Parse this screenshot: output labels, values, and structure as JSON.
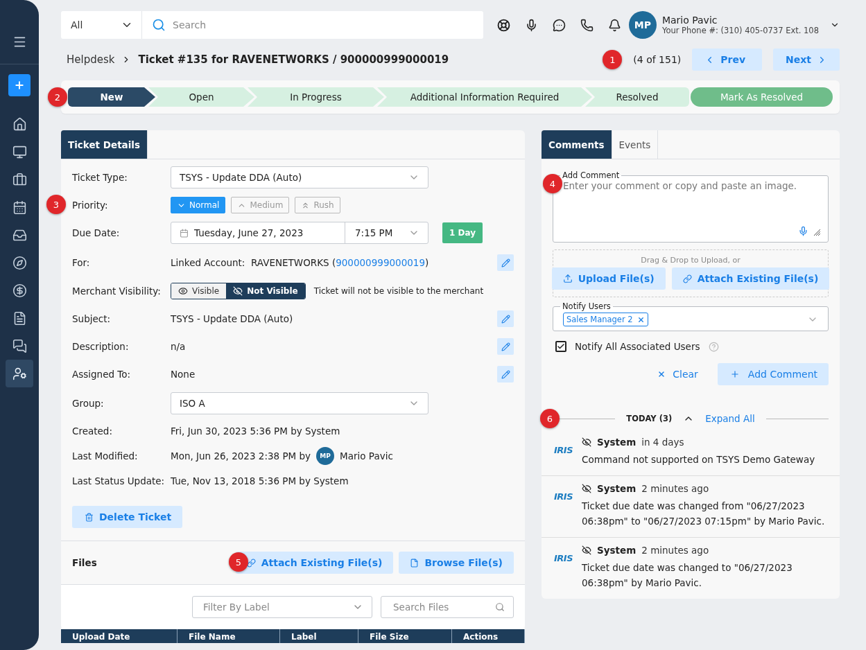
{
  "sidebar": {
    "items": [
      {
        "kind": "menu",
        "selected": false
      },
      {
        "kind": "add",
        "selected": false
      },
      {
        "kind": "home",
        "selected": false
      },
      {
        "kind": "monitor",
        "selected": false
      },
      {
        "kind": "briefcase",
        "selected": false
      },
      {
        "kind": "calendar",
        "selected": false
      },
      {
        "kind": "inbox",
        "selected": false
      },
      {
        "kind": "compass",
        "selected": false
      },
      {
        "kind": "dollar",
        "selected": false
      },
      {
        "kind": "document",
        "selected": false
      },
      {
        "kind": "chat",
        "selected": false
      },
      {
        "kind": "user-settings",
        "selected": true
      }
    ]
  },
  "search": {
    "scope": "All",
    "placeholder": "Search"
  },
  "user": {
    "initials": "MP",
    "name": "Mario Pavic",
    "phone": "Your Phone #: (310) 405-0737 Ext. 108"
  },
  "breadcrumb": {
    "root": "Helpdesk",
    "current": "Ticket #135 for RAVENETWORKS / 900000999000019"
  },
  "pager": {
    "position": "(4 of 151)",
    "prev": "Prev",
    "next": "Next"
  },
  "stages": [
    {
      "label": "New",
      "selected": true
    },
    {
      "label": "Open",
      "selected": false
    },
    {
      "label": "In Progress",
      "selected": false
    },
    {
      "label": "Additional Information Required",
      "selected": false
    },
    {
      "label": "Resolved",
      "selected": false
    }
  ],
  "resolve_button": "Mark As Resolved",
  "markers": [
    "1",
    "2",
    "3",
    "4",
    "5",
    "6"
  ],
  "ticket_details": {
    "tab": "Ticket Details",
    "fields": [
      {
        "kind": "select",
        "label": "Ticket Type:",
        "value": "TSYS - Update DDA (Auto)"
      },
      {
        "kind": "priority",
        "label": "Priority:",
        "options": [
          {
            "label": "Normal",
            "selected": true
          },
          {
            "label": "Medium",
            "selected": false
          },
          {
            "label": "Rush",
            "selected": false
          }
        ]
      },
      {
        "kind": "due",
        "label": "Due Date:",
        "date": "Tuesday, June 27, 2023",
        "time": "7:15 PM",
        "badge": "1 Day"
      },
      {
        "kind": "linked",
        "label": "For:",
        "prefix": "Linked Account:",
        "account": "RAVENETWORKS (",
        "link": "900000999000019",
        "close": ")",
        "editable": true
      },
      {
        "kind": "visibility",
        "label": "Merchant Visibility:",
        "options": [
          {
            "label": "Visible",
            "selected": false
          },
          {
            "label": "Not Visible",
            "selected": true
          }
        ],
        "note": "Ticket will not be visible to the merchant"
      },
      {
        "kind": "text",
        "label": "Subject:",
        "value": "TSYS - Update DDA (Auto)",
        "editable": true
      },
      {
        "kind": "text",
        "label": "Description:",
        "value": "n/a",
        "editable": true
      },
      {
        "kind": "text",
        "label": "Assigned To:",
        "value": "None",
        "editable": true
      },
      {
        "kind": "select",
        "label": "Group:",
        "value": "ISO A"
      },
      {
        "kind": "text",
        "label": "Created:",
        "value": "Fri, Jun 30, 2023 5:36 PM by System",
        "editable": false
      },
      {
        "kind": "user",
        "label": "Last Modified:",
        "value": "Mon, Jun 26, 2023 2:38 PM by",
        "initials": "MP",
        "user": "Mario Pavic"
      },
      {
        "kind": "text",
        "label": "Last Status Update:",
        "value": "Tue, Nov 13, 2018 5:36 PM by System",
        "editable": false
      }
    ],
    "delete_button": "Delete Ticket"
  },
  "files": {
    "title": "Files",
    "attach": "Attach Existing File(s)",
    "browse": "Browse File(s)",
    "filter_placeholder": "Filter By Label",
    "search_placeholder": "Search Files",
    "columns": [
      "Upload Date",
      "File Name",
      "Label",
      "File Size",
      "Actions"
    ]
  },
  "comments": {
    "tabs": [
      {
        "label": "Comments",
        "selected": true
      },
      {
        "label": "Events",
        "selected": false
      }
    ],
    "comment_label": "Add Comment",
    "comment_placeholder": "Enter your comment or copy and paste an image.",
    "drop_hint": "Drag & Drop to Upload, or",
    "upload": "Upload File(s)",
    "attach": "Attach Existing File(s)",
    "notify_label": "Notify Users",
    "notify_tags": [
      "Sales Manager 2"
    ],
    "notify_all": {
      "label": "Notify All Associated Users",
      "checked": true
    },
    "clear": "Clear",
    "add": "Add Comment"
  },
  "timeline": {
    "group": "TODAY (3)",
    "expanded": true,
    "expand_all": "Expand All",
    "entries": [
      {
        "logo": "IRIS",
        "author": "System",
        "time": "in 4 days",
        "text": "Command not supported on TSYS Demo Gateway"
      },
      {
        "logo": "IRIS",
        "author": "System",
        "time": "2 minutes ago",
        "text": "Ticket due date was changed from \"06/27/2023 06:38pm\" to \"06/27/2023 07:15pm\" by Mario Pavic."
      },
      {
        "logo": "IRIS",
        "author": "System",
        "time": "2 minutes ago",
        "text": "Ticket due date was changed to \"06/27/2023 06:38pm\" by Mario Pavic."
      }
    ]
  }
}
